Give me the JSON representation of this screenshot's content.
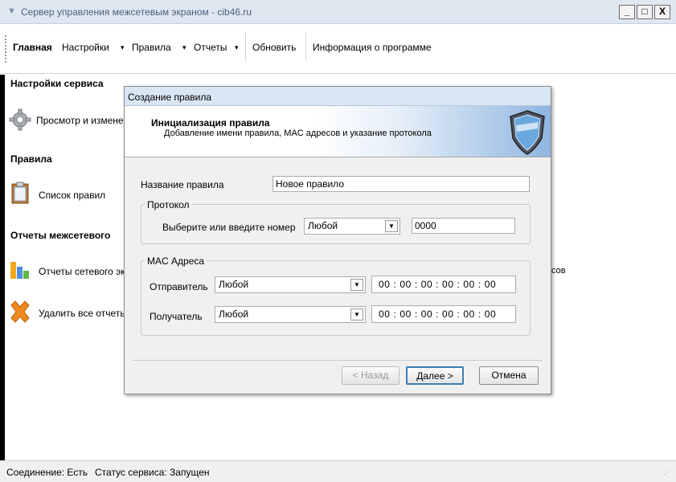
{
  "window": {
    "title": "Сервер управления межсетевым экраном - cib46.ru",
    "minimize": "_",
    "maximize": "□",
    "close": "X"
  },
  "menu": {
    "home": "Главная",
    "settings": "Настройки",
    "rules": "Правила",
    "reports": "Отчеты",
    "refresh": "Обновить",
    "about": "Информация о программе",
    "dropdown_glyph": "▾"
  },
  "sidebar": {
    "service_settings_header": "Настройки сервиса",
    "view_edit": "Просмотр и измене",
    "rules_header": "Правила",
    "rule_list": "Список правил",
    "reports_header": "Отчеты межсетевого",
    "network_reports": "Отчеты сетевого эк",
    "delete_reports": "Удалить все отчеть"
  },
  "background": {
    "truncated_text": "сов"
  },
  "dialog": {
    "title": "Создание правила",
    "heading": "Инициализация правила",
    "subheading": "Добавление имени правила, MAC адресов и указание протокола",
    "rule_name_label": "Название правила",
    "rule_name_value": "Новое правило",
    "protocol_group": "Протокол",
    "protocol_label": "Выберите или введите номер",
    "protocol_value": "Любой",
    "protocol_number": "0000",
    "mac_group": "MAC Адреса",
    "sender_label": "Отправитель",
    "sender_value": "Любой",
    "sender_mac": "00 : 00 : 00 : 00 : 00 : 00",
    "receiver_label": "Получатель",
    "receiver_value": "Любой",
    "receiver_mac": "00 : 00 : 00 : 00 : 00 : 00",
    "back_button": "< Назад",
    "next_button": "Далее >",
    "cancel_button": "Отмена"
  },
  "statusbar": {
    "connection": "Соединение: Есть",
    "service_status": "Статус сервиса: Запущен"
  },
  "icons": {
    "app": "shield-icon",
    "gear": "gear-icon",
    "clipboard": "clipboard-icon",
    "chart": "bar-chart-icon",
    "delete": "delete-x-icon",
    "dialog_logo": "shield-logo-icon"
  },
  "colors": {
    "titlebar": "#dfe7f1",
    "dialog_header_gradient_end": "#8fb6e0",
    "default_button_border": "#3c7fb1"
  }
}
